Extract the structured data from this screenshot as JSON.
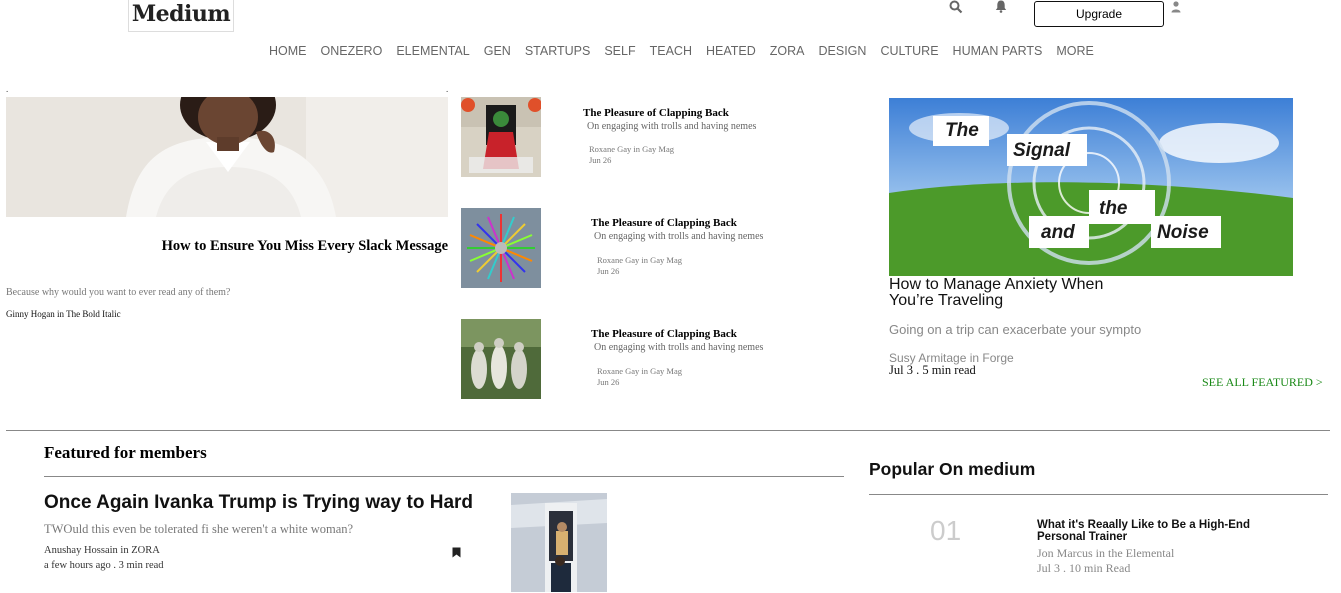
{
  "header": {
    "logo": "Medium",
    "upgrade_label": "Upgrade",
    "icons": [
      "search-icon",
      "bell-icon",
      "user-icon"
    ]
  },
  "nav": {
    "items": [
      "HOME",
      "ONEZERO",
      "ELEMENTAL",
      "GEN",
      "STARTUPS",
      "SELF",
      "TEACH",
      "HEATED",
      "ZORA",
      "DESIGN",
      "CULTURE",
      "HUMAN PARTS",
      "MORE"
    ]
  },
  "hero": {
    "title": "How to Ensure You Miss Every Slack Message",
    "subtitle": "Because why would you want to ever read any of them?",
    "author": "Ginny Hogan in The Bold Italic"
  },
  "middle": {
    "items": [
      {
        "title": "The Pleasure of Clapping Back",
        "subtitle": "On engaging with trolls and having nemes",
        "author": "Roxane Gay in Gay Mag",
        "date": "Jun 26"
      },
      {
        "title": "The Pleasure of Clapping Back",
        "subtitle": "On engaging with trolls and having nemes",
        "author": "Roxane Gay in Gay Mag",
        "date": "Jun 26"
      },
      {
        "title": "The Pleasure of Clapping Back",
        "subtitle": "On engaging with trolls and having nemes",
        "author": "Roxane Gay in Gay Mag",
        "date": "Jun 26"
      }
    ]
  },
  "featured": {
    "title": "How to Manage Anxiety When You’re Traveling",
    "subtitle": "Going on a trip can exacerbate your sympto",
    "author": "Susy Armitage in Forge",
    "date": "Jul 3 . 5 min read",
    "see_all": "SEE ALL FEATURED >",
    "image_words": [
      "The",
      "Signal",
      "and",
      "the",
      "Noise"
    ]
  },
  "members": {
    "heading": "Featured for members",
    "title": "Once Again Ivanka Trump is Trying way to Hard",
    "subtitle": "TWOuld this even be tolerated fi she weren't a white woman?",
    "author": "Anushay Hossain in ZORA",
    "date": "a few hours ago . 3 min read"
  },
  "popular": {
    "heading": "Popular On medium",
    "items": [
      {
        "number": "01",
        "title": "What it's Reaally Like to Be a High-End Personal Trainer",
        "author": "Jon Marcus in the Elemental",
        "date": "Jul 3 . 10 min Read"
      }
    ]
  },
  "colors": {
    "accent_green": "#1a8917"
  }
}
